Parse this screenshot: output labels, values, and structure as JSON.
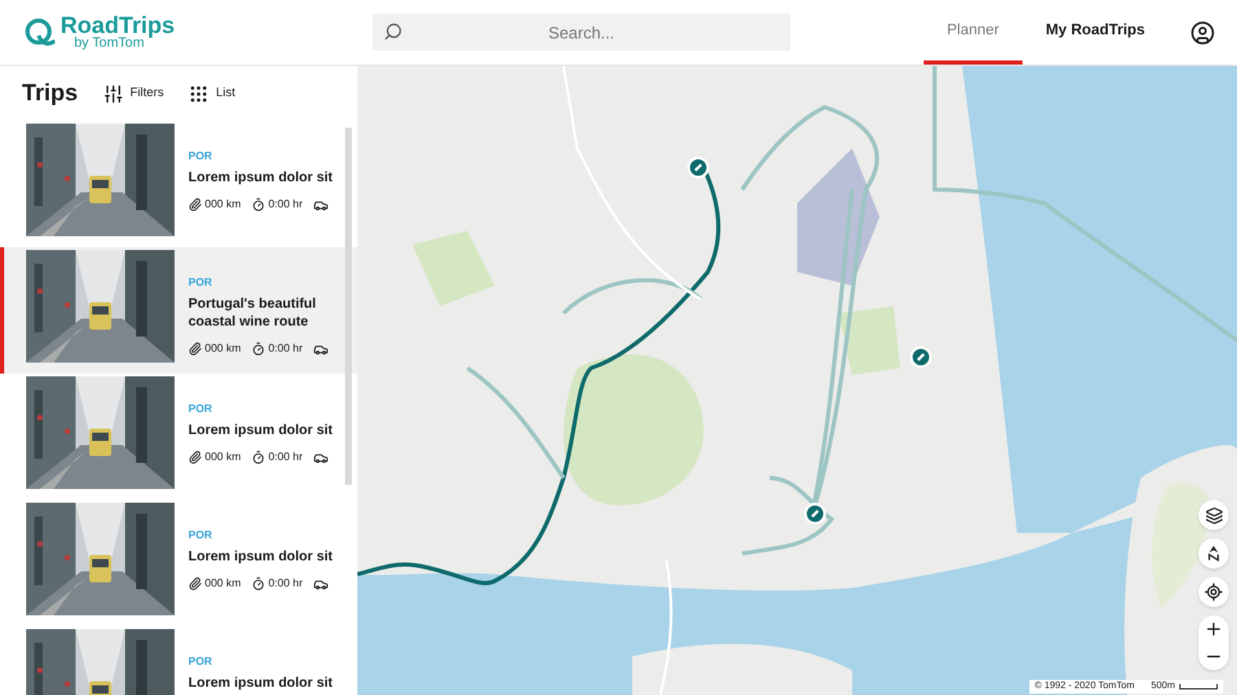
{
  "brand": {
    "name": "RoadTrips",
    "tagline": "by TomTom"
  },
  "search": {
    "placeholder": "Search..."
  },
  "nav": [
    {
      "label": "Planner",
      "selected": true
    },
    {
      "label": "My RoadTrips",
      "selected": false
    }
  ],
  "sidebar": {
    "title": "Trips",
    "actions": [
      {
        "kind": "filters",
        "label": "Filters"
      },
      {
        "kind": "list",
        "label": "List"
      }
    ]
  },
  "trips": [
    {
      "country": "POR",
      "title": "Lorem ipsum dolor sit",
      "distance": "000 km",
      "duration": "0:00 hr",
      "selected": false
    },
    {
      "country": "POR",
      "title": "Portugal's beautiful coastal wine route",
      "distance": "000 km",
      "duration": "0:00 hr",
      "selected": true
    },
    {
      "country": "POR",
      "title": "Lorem ipsum dolor sit",
      "distance": "000 km",
      "duration": "0:00 hr",
      "selected": false
    },
    {
      "country": "POR",
      "title": "Lorem ipsum dolor sit",
      "distance": "000 km",
      "duration": "0:00 hr",
      "selected": false
    },
    {
      "country": "POR",
      "title": "Lorem ipsum dolor sit",
      "selected": false
    }
  ],
  "map": {
    "attribution": "© 1992 - 2020 TomTom",
    "scale": "500m"
  }
}
